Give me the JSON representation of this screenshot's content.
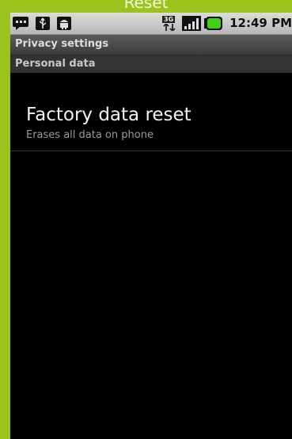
{
  "banner": {
    "title": "Reset"
  },
  "status_bar": {
    "time": "12:49 PM",
    "network_label": "3G",
    "icons": [
      "message-icon",
      "usb-icon",
      "android-debug-icon",
      "3g-data-icon",
      "signal-icon",
      "battery-icon"
    ]
  },
  "title_bar": {
    "title": "Privacy settings"
  },
  "section": {
    "header": "Personal data"
  },
  "items": [
    {
      "title": "Factory data reset",
      "summary": "Erases all data on phone"
    }
  ],
  "colors": {
    "banner": "#9cc21b",
    "battery": "#3fcf16",
    "background": "#000000"
  }
}
